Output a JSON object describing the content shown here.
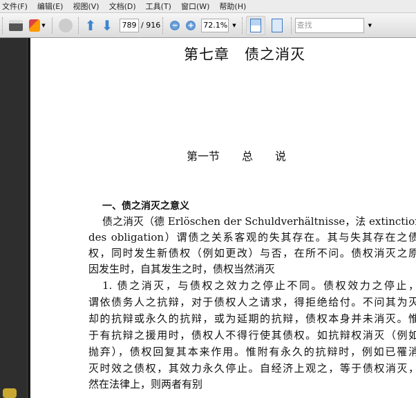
{
  "menu": [
    "文件(F)",
    "编辑(E)",
    "视图(V)",
    "文档(D)",
    "工具(T)",
    "窗口(W)",
    "帮助(H)"
  ],
  "toolbar": {
    "current_page": "789",
    "total_pages": "/ 916",
    "zoom": "72.1%",
    "find_placeholder": "查找"
  },
  "document": {
    "chapter_title": "第七章　债之消灭",
    "section_title": "第一节　　总　　说",
    "heading": "一、债之消灭之意义",
    "lines": [
      "债之消灭（德 Erlöschen der Schuldverhältnisse，法 extinction",
      "des obligation）谓债之关系客观的失其存在。其与失其存在之债",
      "权，同时发生新债权（例如更改）与否，在所不问。债权消灭之原",
      "因发生时，自其发生之时，债权当然消灭",
      "1. 债之消灭，与债权之效力之停止不同。债权效力之停止，",
      "谓依债务人之抗辩，对于债权人之请求，得拒绝给付。不问其为灭",
      "却的抗辩或永久的抗辩，或为延期的抗辩，债权本身并未消灭。惟",
      "于有抗辩之援用时，债权人不得行使其债权。如抗辩权消灭（例如",
      "抛弃），债权回复其本来作用。惟附有永久的抗辩时，例如已罹消",
      "灭时效之债权，其效力永久停止。自经济上观之，等于债权消灭，",
      "然在法律上，则两者有别"
    ]
  }
}
